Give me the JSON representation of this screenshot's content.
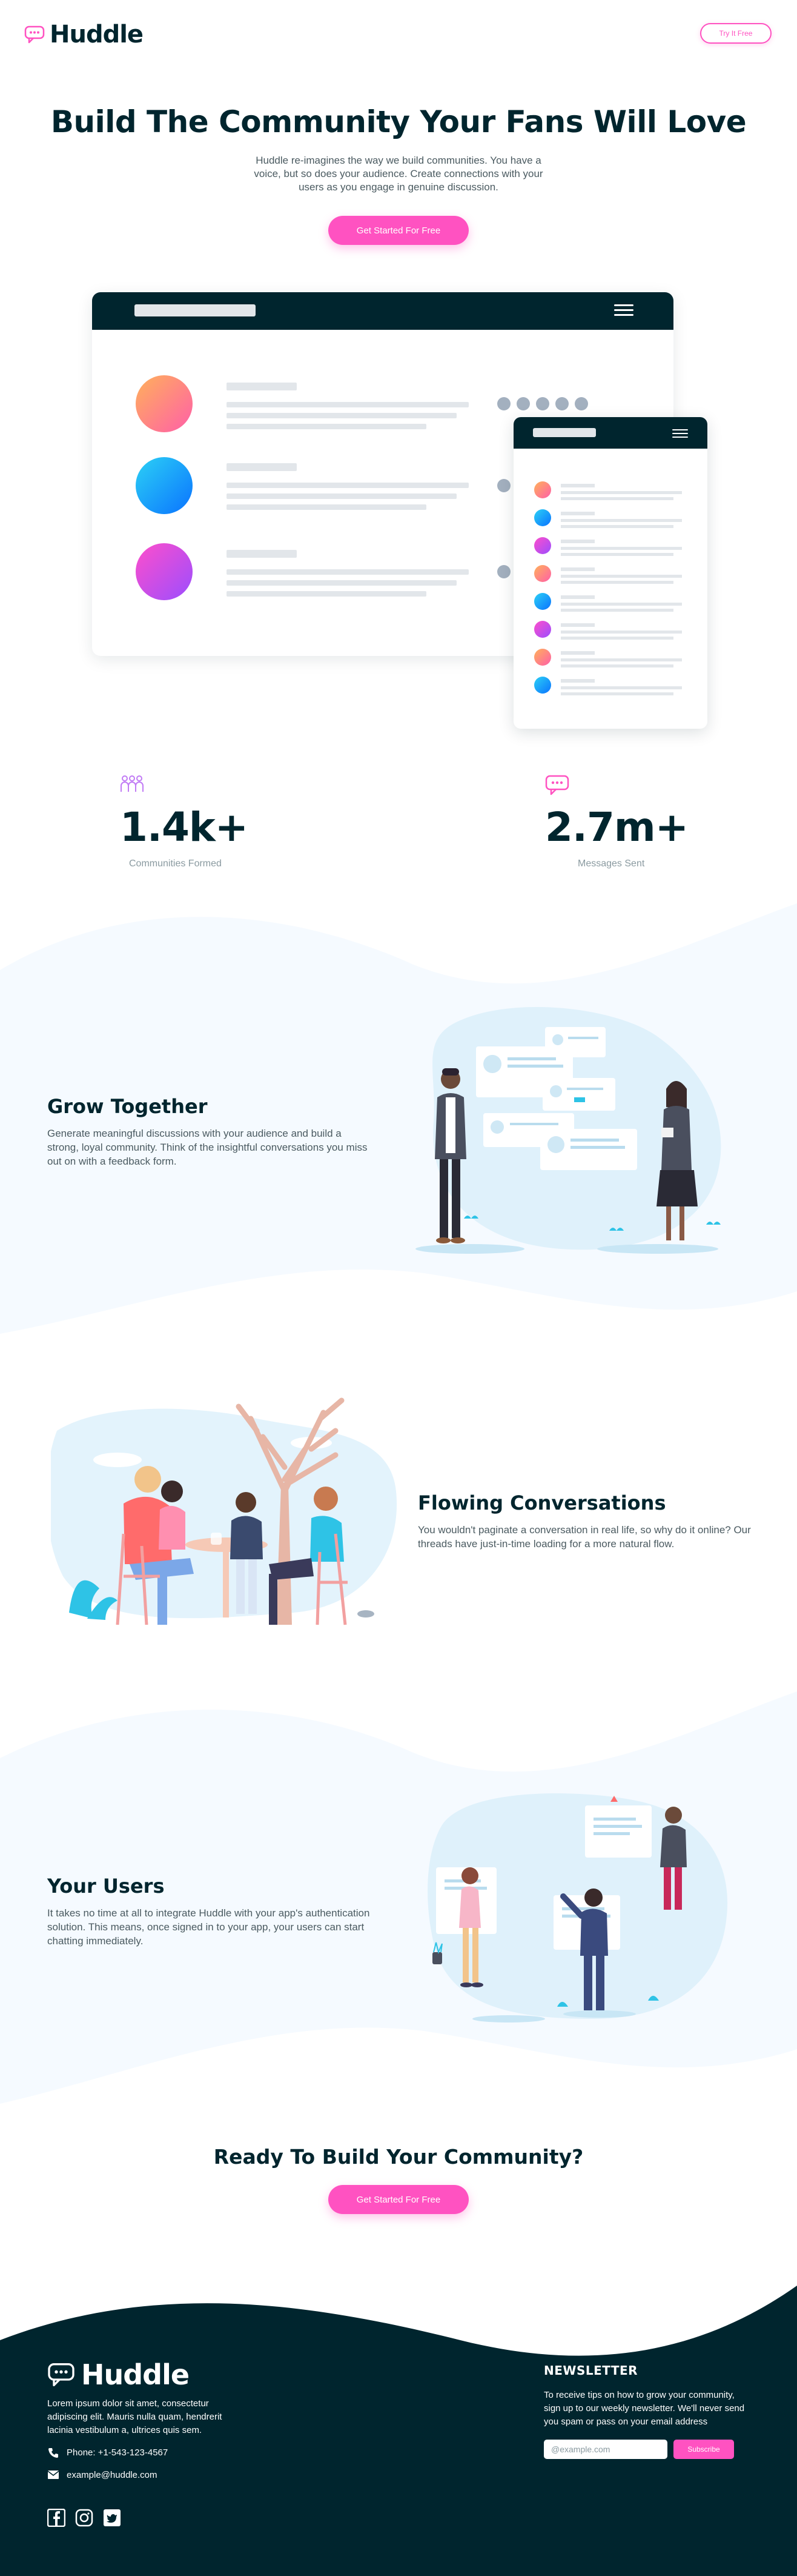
{
  "header": {
    "brand": "Huddle",
    "cta_label": "Try It Free"
  },
  "hero": {
    "title": "Build The Community Your Fans Will Love",
    "description": "Huddle re-imagines the way we build communities. You have a voice, but so does your audience. Create connections with your users as you engage in genuine discussion.",
    "cta_label": "Get Started For Free"
  },
  "stats": [
    {
      "number": "1.4k+",
      "label": "Communities Formed",
      "icon": "communities-icon"
    },
    {
      "number": "2.7m+",
      "label": "Messages Sent",
      "icon": "messages-icon"
    }
  ],
  "features": [
    {
      "title": "Grow Together",
      "text": "Generate meaningful discussions with your audience and build a strong, loyal community. Think of the insightful conversations you miss out on with a feedback form."
    },
    {
      "title": "Flowing Conversations",
      "text": "You wouldn't paginate a conversation in real life, so why do it online? Our threads have just-in-time loading for a more natural flow."
    },
    {
      "title": "Your Users",
      "text": "It takes no time at all to integrate Huddle with your app's authentication solution. This means, once signed in to your app, your users can start chatting immediately."
    }
  ],
  "cta": {
    "title": "Ready To Build Your Community?",
    "button_label": "Get Started For Free"
  },
  "footer": {
    "brand": "Huddle",
    "about": "Lorem ipsum dolor sit amet, consectetur adipiscing elit. Mauris nulla quam, hendrerit lacinia vestibulum a, ultrices quis sem.",
    "phone": "Phone: +1-543-123-4567",
    "email": "example@huddle.com",
    "newsletter_title": "NEWSLETTER",
    "newsletter_text": "To receive tips on how to grow your community, sign up to our weekly newsletter. We'll never send you spam or pass on your email address",
    "newsletter_placeholder": "@example.com",
    "subscribe_label": "Subscribe",
    "social": [
      "facebook-icon",
      "instagram-icon",
      "twitter-icon"
    ]
  },
  "colors": {
    "dark": "#00252e",
    "pink": "#ff52c1",
    "light_bg": "#f5faff"
  }
}
